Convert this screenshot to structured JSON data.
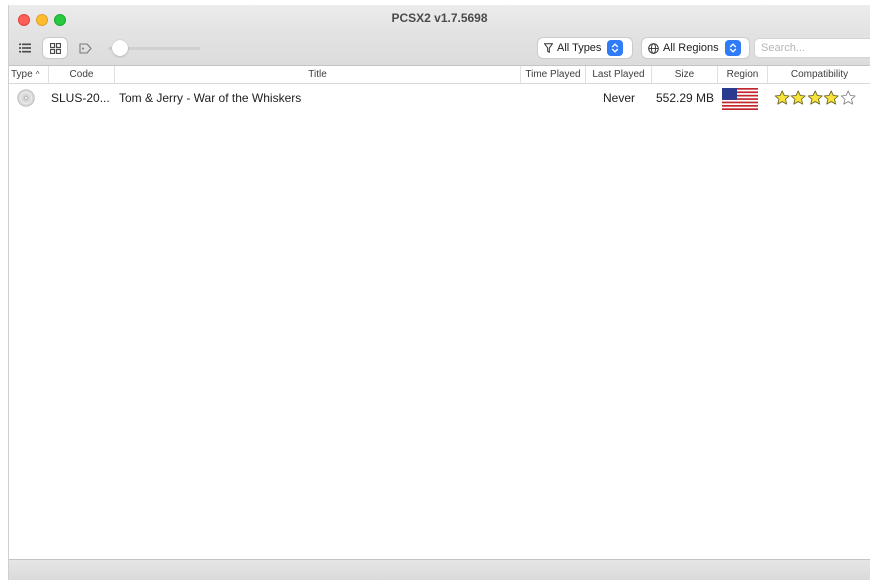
{
  "window": {
    "title": "PCSX2 v1.7.5698"
  },
  "toolbar": {
    "view_list_icon": "list-icon",
    "view_grid_icon": "grid-icon",
    "view_tag_icon": "tag-icon",
    "zoom_level": 0.1,
    "types_filter": "All Types",
    "regions_filter": "All Regions",
    "search_placeholder": "Search..."
  },
  "columns": [
    "Type",
    "Code",
    "Title",
    "Time Played",
    "Last Played",
    "Size",
    "Region",
    "Compatibility"
  ],
  "games": [
    {
      "type_icon": "disc-icon",
      "code": "SLUS-20...",
      "title": "Tom & Jerry - War of the Whiskers",
      "time_played": "",
      "last_played": "Never",
      "size": "552.29 MB",
      "region_flag": "us-flag-icon",
      "compatibility": 4,
      "compatibility_max": 5
    }
  ],
  "colors": {
    "accent": "#2f7cf6",
    "close": "#fe5f57",
    "minimize": "#febc2e",
    "maximize": "#28c840",
    "star_fill": "#f7e33a"
  }
}
